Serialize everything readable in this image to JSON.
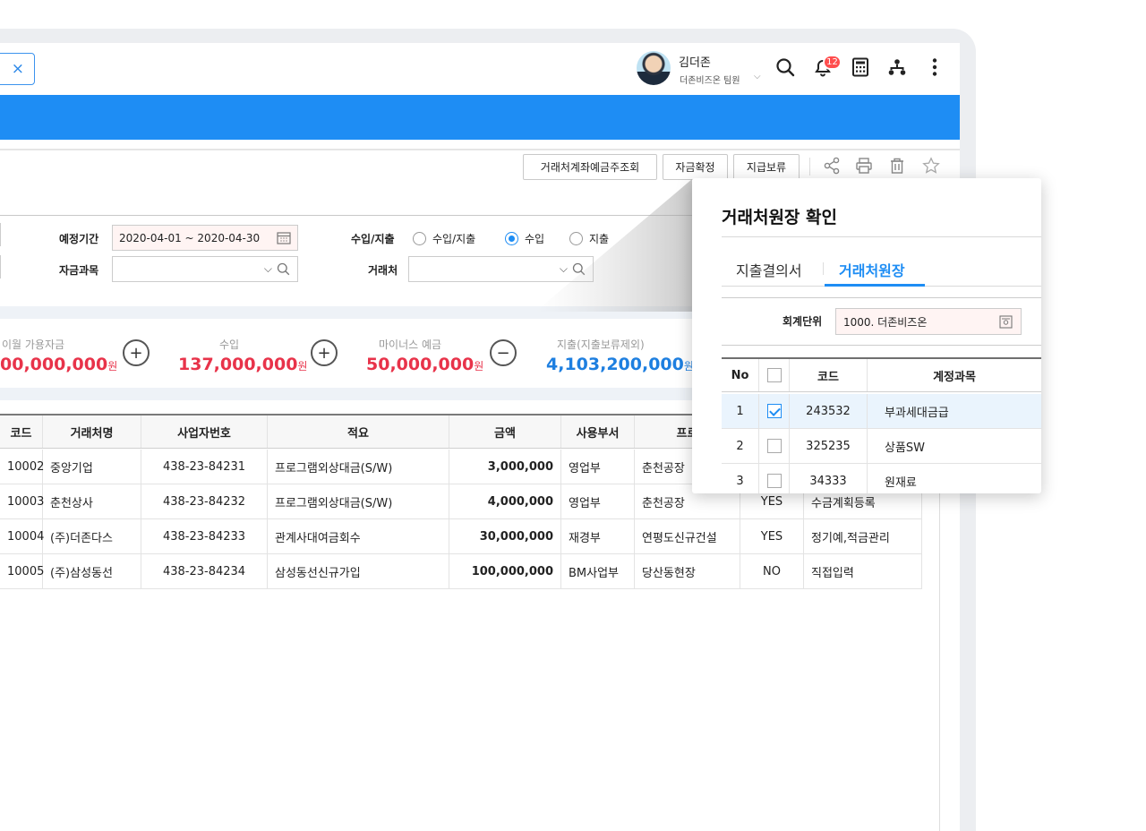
{
  "header": {
    "tab_close": "×",
    "user_name": "김더존",
    "user_role": "더존비즈온 팀원",
    "caret": "⌵",
    "notification_count": "12"
  },
  "toolbar": {
    "btn_account_deposit": "거래처계좌예금주조회",
    "btn_confirm_funds": "자금확정",
    "btn_hold_payment": "지급보류"
  },
  "search": {
    "period_label": "예정기간",
    "period_value": "2020-04-01 ~ 2020-04-30",
    "io_label": "수입/지출",
    "radio_both": "수입/지출",
    "radio_income": "수입",
    "radio_expense": "지출",
    "selected_radio": "수입",
    "subject_label": "자금과목",
    "partner_label": "거래처"
  },
  "summary": {
    "carryover_label": "이월 가용자금",
    "carryover_value": "00,000,000",
    "income_label": "수입",
    "income_value": "137,000,000",
    "minus_label": "마이너스 예금",
    "minus_value": "50,000,000",
    "expense_label": "지출(지출보류제외)",
    "expense_value": "4,103,200,000",
    "won": "원",
    "plus": "+",
    "minus": "−"
  },
  "table": {
    "headers": [
      "코드",
      "거래처명",
      "사업자번호",
      "적요",
      "금액",
      "사용부서",
      "프로",
      "",
      ""
    ],
    "rows": [
      [
        "10002",
        "중앙기업",
        "438-23-84231",
        "프로그램외상대금(S/W)",
        "3,000,000",
        "영업부",
        "춘천공장",
        "",
        ""
      ],
      [
        "10003",
        "춘천상사",
        "438-23-84232",
        "프로그램외상대금(S/W)",
        "4,000,000",
        "영업부",
        "춘천공장",
        "YES",
        "수금계획등록"
      ],
      [
        "10004",
        "(주)더존다스",
        "438-23-84233",
        "관계사대여금회수",
        "30,000,000",
        "재경부",
        "연평도신규건설",
        "YES",
        "정기예,적금관리"
      ],
      [
        "10005",
        "(주)삼성동선",
        "438-23-84234",
        "삼성동선신규가입",
        "100,000,000",
        "BM사업부",
        "당산동현장",
        "NO",
        "직접입력"
      ]
    ]
  },
  "popup": {
    "title": "거래처원장 확인",
    "tab1": "지출결의서",
    "tab2": "거래처원장",
    "unit_label": "회계단위",
    "unit_value": "1000. 더존비즈온",
    "headers": [
      "No",
      "",
      "코드",
      "계정과목"
    ],
    "rows": [
      {
        "no": "1",
        "checked": true,
        "code": "243532",
        "account": "부과세대금급"
      },
      {
        "no": "2",
        "checked": false,
        "code": "325235",
        "account": "상품SW"
      },
      {
        "no": "3",
        "checked": false,
        "code": "34333",
        "account": "원재료"
      }
    ]
  },
  "colors": {
    "accent": "#1e8df4",
    "amount_red": "#e8334a",
    "badge_red": "#ff4d4d"
  }
}
